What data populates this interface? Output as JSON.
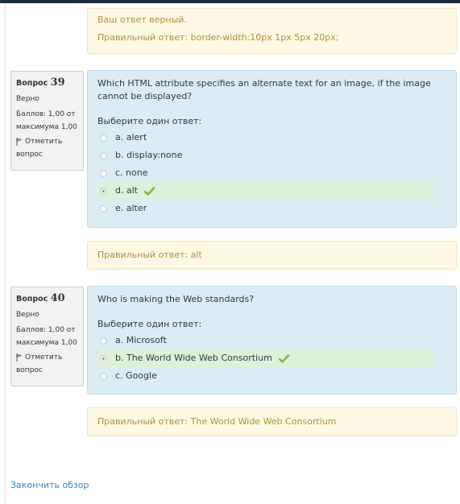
{
  "prev_feedback": {
    "correct_msg": "Ваш ответ верный.",
    "right_answer": "Правильный ответ: border-width:10px 1px 5px 20px;"
  },
  "questions": [
    {
      "label": "Вопрос",
      "number": "39",
      "state": "Верно",
      "grade": "Баллов: 1,00 от максимума 1,00",
      "flag_label": "Отметить вопрос",
      "text": "Which HTML attribute specifies an alternate text for an image, if the image cannot be displayed?",
      "prompt": "Выберите один ответ:",
      "options": [
        "a. alert",
        "b. display:none",
        "c. none",
        "d. alt",
        "e. alter"
      ],
      "selected_index": 3,
      "right_answer": "Правильный ответ: alt"
    },
    {
      "label": "Вопрос",
      "number": "40",
      "state": "Верно",
      "grade": "Баллов: 1,00 от максимума 1,00",
      "flag_label": "Отметить вопрос",
      "text": "Who is making the Web standards?",
      "prompt": "Выберите один ответ:",
      "options": [
        "a. Microsoft",
        "b. The World Wide Web Consortium",
        "c. Google"
      ],
      "selected_index": 1,
      "right_answer": "Правильный ответ: The World Wide Web Consortium"
    }
  ],
  "finish_link": "Закончить обзор",
  "colors": {
    "feedback_bg": "#fcf8e3",
    "question_bg": "#dcecf5",
    "correct_bg": "#dff0d8",
    "check": "#7cb342",
    "link": "#3a84c4"
  },
  "icons": {
    "flag": "flag-icon",
    "check": "checkmark-icon"
  }
}
